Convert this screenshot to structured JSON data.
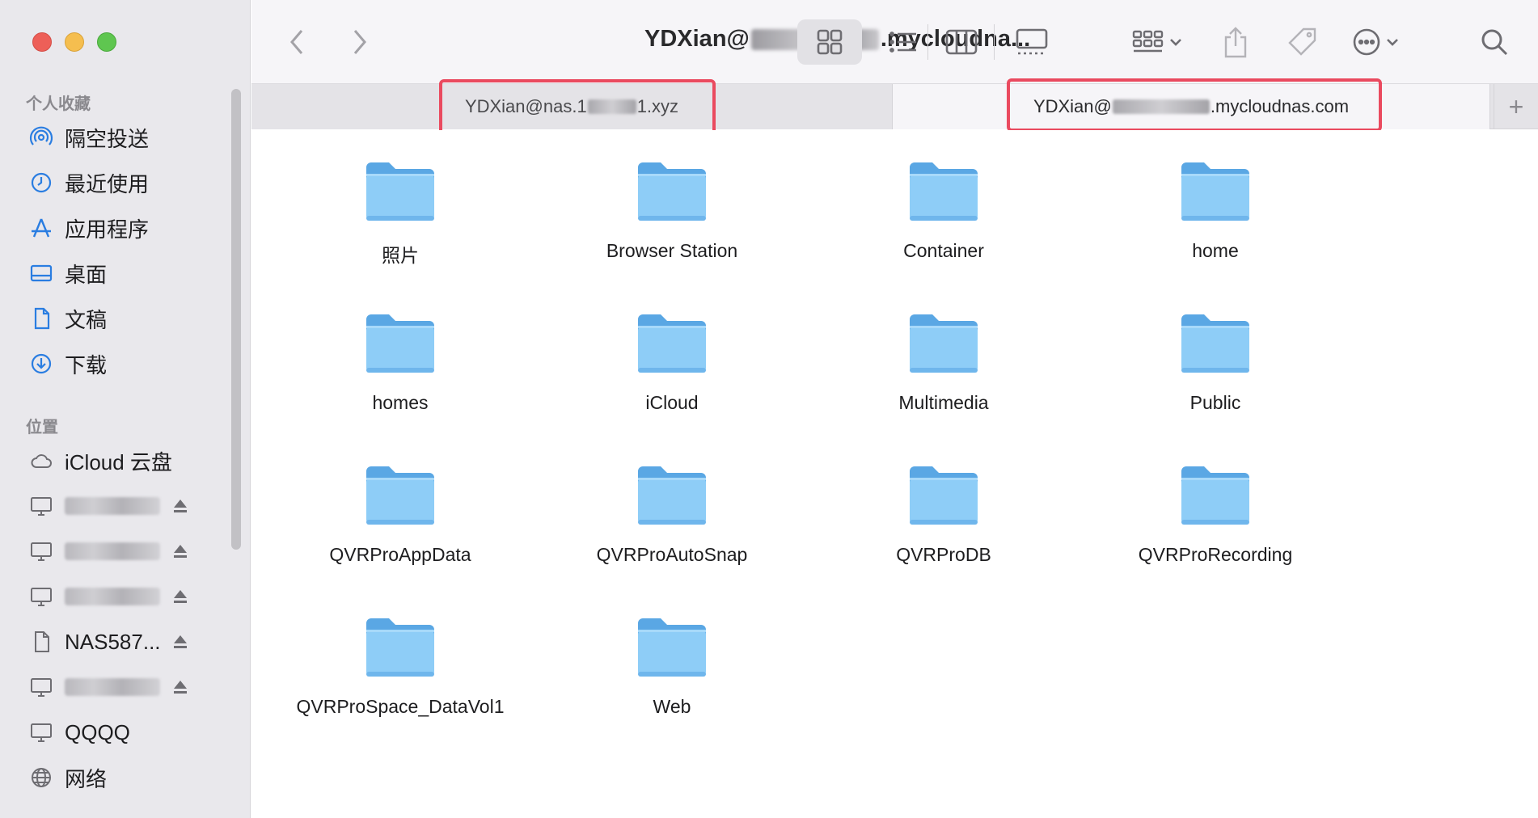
{
  "window": {
    "title_prefix": "YDXian@",
    "title_suffix": ".mycloudna..."
  },
  "toolbar": {
    "back_icon": "chevron-left-icon",
    "forward_icon": "chevron-right-icon",
    "views": [
      "icon-view",
      "list-view",
      "column-view",
      "gallery-view"
    ],
    "active_view": "icon-view",
    "group_icon": "group-icon",
    "share_icon": "share-icon",
    "tag_icon": "tag-icon",
    "more_icon": "more-icon",
    "search_icon": "search-icon"
  },
  "tabs": [
    {
      "prefix": "YDXian@nas.1",
      "suffix": "1.xyz",
      "active": false
    },
    {
      "prefix": "YDXian@",
      "suffix": ".mycloudnas.com",
      "active": true
    }
  ],
  "tab_add": "+",
  "sidebar": {
    "favorites_header": "个人收藏",
    "favorites": [
      {
        "label": "隔空投送",
        "icon": "airdrop-icon"
      },
      {
        "label": "最近使用",
        "icon": "clock-icon"
      },
      {
        "label": "应用程序",
        "icon": "applications-icon"
      },
      {
        "label": "桌面",
        "icon": "desktop-icon"
      },
      {
        "label": "文稿",
        "icon": "document-icon"
      },
      {
        "label": "下载",
        "icon": "download-icon"
      }
    ],
    "locations_header": "位置",
    "locations": [
      {
        "label": "iCloud 云盘",
        "icon": "cloud-icon",
        "eject": false
      },
      {
        "label": "",
        "icon": "computer-icon",
        "eject": true,
        "blurred": true
      },
      {
        "label": "",
        "icon": "computer-icon",
        "eject": true,
        "blurred": true
      },
      {
        "label": "",
        "icon": "computer-icon",
        "eject": true,
        "blurred": true
      },
      {
        "label": "NAS587...",
        "icon": "file-icon",
        "eject": true
      },
      {
        "label": "",
        "icon": "computer-icon",
        "eject": true,
        "blurred": true
      },
      {
        "label": "QQQQ",
        "icon": "computer-icon",
        "eject": false
      },
      {
        "label": "网络",
        "icon": "globe-icon",
        "eject": false
      }
    ]
  },
  "folders": [
    "照片",
    "Browser Station",
    "Container",
    "home",
    "homes",
    "iCloud",
    "Multimedia",
    "Public",
    "QVRProAppData",
    "QVRProAutoSnap",
    "QVRProDB",
    "QVRProRecording",
    "QVRProSpace_DataVol1",
    "Web"
  ],
  "colors": {
    "folder_body": "#8ecdf7",
    "folder_tab": "#5aa7e4",
    "highlight": "#ea4a5f",
    "sidebar_icon": "#2a7de1"
  }
}
